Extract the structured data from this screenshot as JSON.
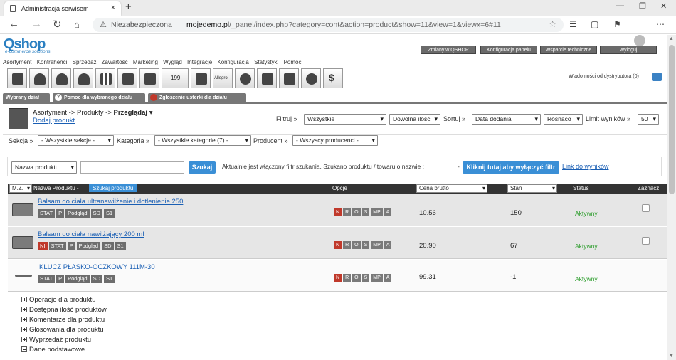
{
  "browser": {
    "tab_title": "Administracja serwisem",
    "tab_close": "×",
    "new_tab": "+",
    "url_warning": "Niezabezpieczona",
    "url_domain": "mojedemo.pl",
    "url_path": "/_panel/index.php?category=cont&action=product&show=11&view=1&viewx=6#11"
  },
  "header": {
    "logo": "Qshop",
    "logo_sub": "e-commerce solutions",
    "buttons": [
      "Zmiany w QSHOP",
      "Konfiguracja panelu",
      "Wsparcie techniczne",
      "Wyloguj"
    ],
    "menu": [
      "Asortyment",
      "Kontrahenci",
      "Sprzedaż",
      "Zawartość",
      "Marketing",
      "Wygląd",
      "Integracje",
      "Konfiguracja",
      "Statystyki",
      "Pomoc"
    ],
    "allegro": "Allegro",
    "badge_199": "199",
    "messages": "Wiadomości od dystrybutora (0)"
  },
  "subtabs": [
    "Wybrany dział",
    "Pomoc dla wybranego działu",
    "Zgłoszenie usterki dla działu"
  ],
  "breadcrumb": {
    "path": "Asortyment -> Produkty -> ",
    "current": "Przeglądaj",
    "add": "Dodaj produkt"
  },
  "filters": {
    "filtruj_label": "Filtruj »",
    "filtruj_value": "Wszystkie",
    "qty_value": "Dowolna ilość",
    "sortuj_label": "Sortuj »",
    "sort_value": "Data dodania",
    "order_value": "Rosnąco",
    "limit_label": "Limit wyników »",
    "limit_value": "50",
    "sekcja_label": "Sekcja »",
    "sekcja_value": "- Wszystkie sekcje -",
    "kategoria_label": "Kategoria »",
    "kategoria_value": "- Wszystkie kategorie (7) -",
    "producent_label": "Producent »",
    "producent_value": "- Wszyscy producenci -"
  },
  "search": {
    "field_value": "Nazwa produktu",
    "input_value": "",
    "button": "Szukaj",
    "info": "Aktualnie jest włączony filtr szukania. Szukano produktu / towaru o nazwie :",
    "dash": "-",
    "disable_button": "Kliknij tutaj aby wyłączyć filtr",
    "results_link": "Link do wyników"
  },
  "table": {
    "mz": "M.Z.",
    "name_header": "Nazwa Produktu -",
    "search_btn": "Szukaj produktu",
    "opcje": "Opcje",
    "price_header": "Cena brutto",
    "stock_header": "Stan",
    "status_header": "Status",
    "check_header": "Zaznacz"
  },
  "products": [
    {
      "name": "Balsam do ciała ultranawilżenie i dotlenienie 250",
      "tags": [
        "STAT",
        "P",
        "Podgląd",
        "SD",
        "S1"
      ],
      "ni": false,
      "price": "10.56",
      "stock": "150",
      "status": "Aktywny"
    },
    {
      "name": "Balsam do ciała nawilżający 200 ml",
      "tags": [
        "STAT",
        "P",
        "Podgląd",
        "SD",
        "S1"
      ],
      "ni": true,
      "price": "20.90",
      "stock": "67",
      "status": "Aktywny"
    },
    {
      "name": "KLUCZ PŁASKO-OCZKOWY 111M-30",
      "tags": [
        "STAT",
        "P",
        "Podgląd",
        "SD",
        "S1"
      ],
      "ni": false,
      "price": "99.31",
      "stock": "-1",
      "status": "Aktywny"
    }
  ],
  "options": [
    "N",
    "R",
    "O",
    "S",
    "MP",
    "A"
  ],
  "ni_label": "NI",
  "tree": [
    "Operacje dla produktu",
    "Dostępna ilość produktów",
    "Komentarze dla produktu",
    "Głosowania dla produktu",
    "Wyprzedaż produktu",
    "Dane podstawowe"
  ]
}
